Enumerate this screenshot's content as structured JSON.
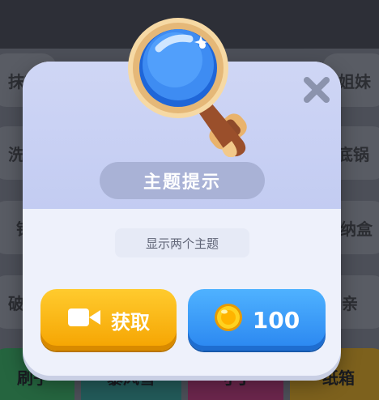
{
  "background": {
    "tiles": [
      {
        "label": "抹布"
      },
      {
        "label": "姐妹"
      },
      {
        "label": "洗洁"
      },
      {
        "label": "底锅"
      },
      {
        "label": "钻"
      },
      {
        "label": "纳盒"
      },
      {
        "label": "破壁"
      },
      {
        "label": "亲"
      }
    ],
    "bottom_tiles": [
      {
        "label": "刷子",
        "color": "#2f8f52"
      },
      {
        "label": "暴风雪",
        "color": "#2a7f7a"
      },
      {
        "label": "寸丁",
        "color": "#9a2f66"
      },
      {
        "label": "纸箱",
        "color": "#b5891e"
      }
    ]
  },
  "dialog": {
    "title": "主题提示",
    "description": "显示两个主题",
    "get_button_label": "获取",
    "coin_button_label": "100",
    "colors": {
      "header": "#c3ccf2",
      "get_button": "#f5a300",
      "coin_button": "#2a86f0"
    },
    "icons": {
      "close": "close-icon",
      "video": "video-camera-icon",
      "coin": "coin-icon",
      "magnifier": "magnifying-glass-icon"
    }
  }
}
